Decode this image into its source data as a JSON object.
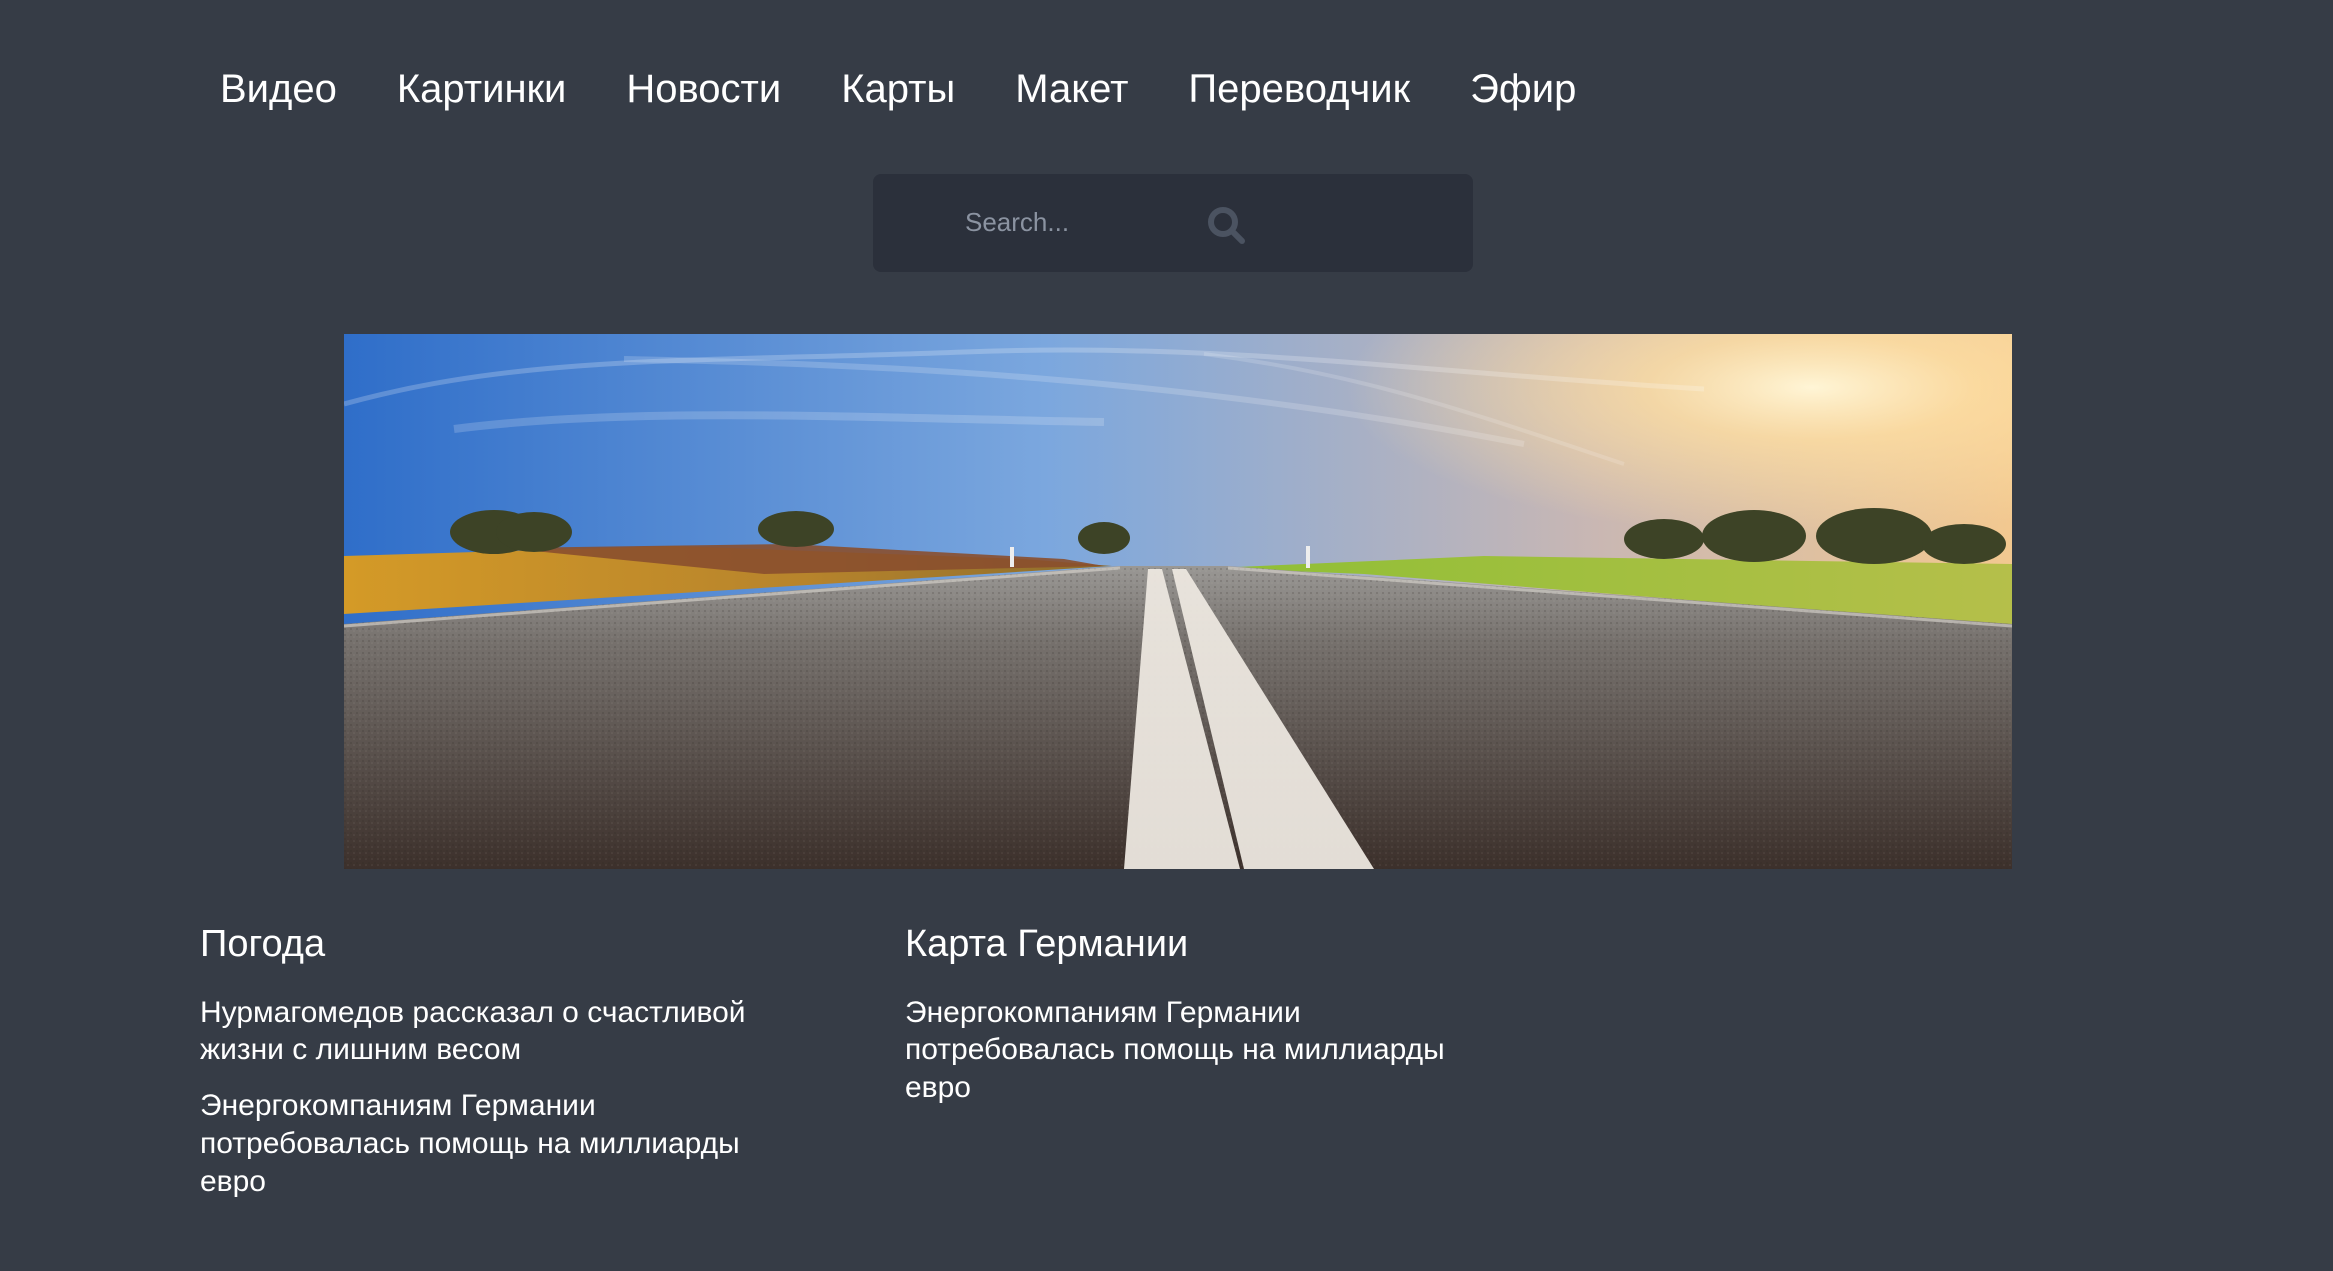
{
  "nav": {
    "items": [
      {
        "label": "Видео"
      },
      {
        "label": "Картинки"
      },
      {
        "label": "Новости"
      },
      {
        "label": "Карты"
      },
      {
        "label": "Макет"
      },
      {
        "label": "Переводчик"
      },
      {
        "label": "Эфир"
      }
    ]
  },
  "search": {
    "placeholder": "Search...",
    "icon": "search-icon"
  },
  "hero": {
    "image": "road-landscape"
  },
  "columns": {
    "left": {
      "title": "Погода",
      "items": [
        {
          "text": "Нурмагомедов рассказал о счастливой жизни с лишним весом"
        },
        {
          "text": "Энергокомпаниям Германии потребовалась помощь на миллиарды евро"
        }
      ]
    },
    "right": {
      "title": "Карта Германии",
      "items": [
        {
          "text": "Энергокомпаниям Германии потребовалась помощь на миллиарды евро"
        }
      ]
    }
  },
  "colors": {
    "background": "#363c46",
    "search_background": "#2b303b",
    "text": "#ffffff",
    "placeholder": "#8b93a1"
  }
}
